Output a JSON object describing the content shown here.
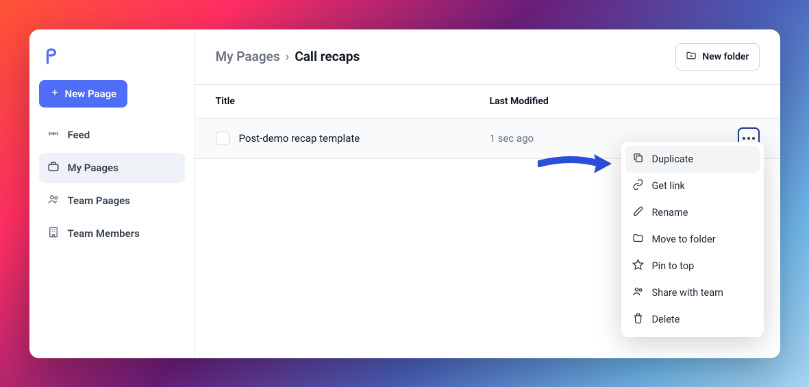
{
  "sidebar": {
    "new_paage_label": "New Paage",
    "items": [
      {
        "label": "Feed"
      },
      {
        "label": "My Paages"
      },
      {
        "label": "Team Paages"
      },
      {
        "label": "Team Members"
      }
    ]
  },
  "breadcrumb": {
    "parent": "My Paages",
    "current": "Call recaps"
  },
  "new_folder_label": "New folder",
  "columns": {
    "title": "Title",
    "modified": "Last Modified"
  },
  "rows": [
    {
      "title": "Post-demo recap template",
      "modified": "1 sec ago"
    }
  ],
  "menu": {
    "duplicate": "Duplicate",
    "get_link": "Get link",
    "rename": "Rename",
    "move": "Move to folder",
    "pin": "Pin to top",
    "share": "Share with team",
    "delete": "Delete"
  }
}
